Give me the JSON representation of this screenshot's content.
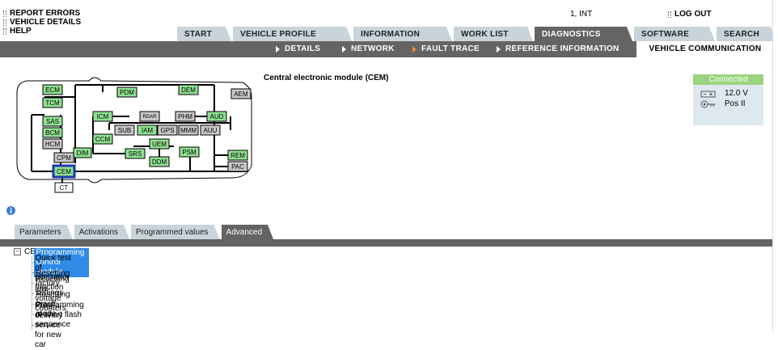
{
  "top_menu": [
    "REPORT ERRORS",
    "VEHICLE DETAILS",
    "HELP"
  ],
  "user": "1, INT",
  "logout": "LOG OUT",
  "tabs": {
    "start": "START",
    "vehicle_profile": "VEHICLE PROFILE",
    "information": "INFORMATION",
    "work_list": "WORK LIST",
    "diagnostics": "DIAGNOSTICS",
    "software": "SOFTWARE",
    "search": "SEARCH",
    "active": "DIAGNOSTICS"
  },
  "subtabs": {
    "details": "DETAILS",
    "network": "NETWORK",
    "fault_trace": "FAULT TRACE",
    "reference_information": "REFERENCE INFORMATION",
    "vehicle_communication": "VEHICLE COMMUNICATION"
  },
  "module_title": "Central electronic module (CEM)",
  "connection": {
    "status": "Connected",
    "voltage": "12.0 V",
    "ignition": "Pos II",
    "status_color": "#9ad37d"
  },
  "network_modules": {
    "ECM": "ECM",
    "TCM": "TCM",
    "SAS": "SAS",
    "BCM": "BCM",
    "HCM": "HCM",
    "CPM": "CPM",
    "CEM": "CEM",
    "CT": "CT",
    "DIM": "DIM",
    "PDM": "PDM",
    "DEM": "DEM",
    "AEM": "AEM",
    "ICM": "ICM",
    "RDAR": "RDAR",
    "PHM": "PHM",
    "AUD": "AUD",
    "SUB": "SUB",
    "IAM": "IAM",
    "GPS": "GPS",
    "MMM": "MMM",
    "AUU": "AUU",
    "CCM": "CCM",
    "UEM": "UEM",
    "SRS": "SRS",
    "PSM": "PSM",
    "DDM": "DDM",
    "REM": "REM",
    "PAC": "PAC"
  },
  "colors": {
    "active_module": "#90e090",
    "inactive_module": "#c8c8c8",
    "selected_border": "#1a3aa8"
  },
  "lower_tabs": {
    "parameters": "Parameters",
    "activations": "Activations",
    "programmed_values": "Programmed values",
    "advanced": "Advanced",
    "active": "Advanced"
  },
  "tree": {
    "root": "CEM",
    "expander": "−",
    "items": [
      "Programming control module",
      "Quick test of alternator function",
      "Resetting factory settings",
      "Resetting low voltage counters",
      "Resetting crash mode",
      "Programming of short flash sequence",
      "Pre-delivery service for new car"
    ],
    "selected_index": 0
  }
}
